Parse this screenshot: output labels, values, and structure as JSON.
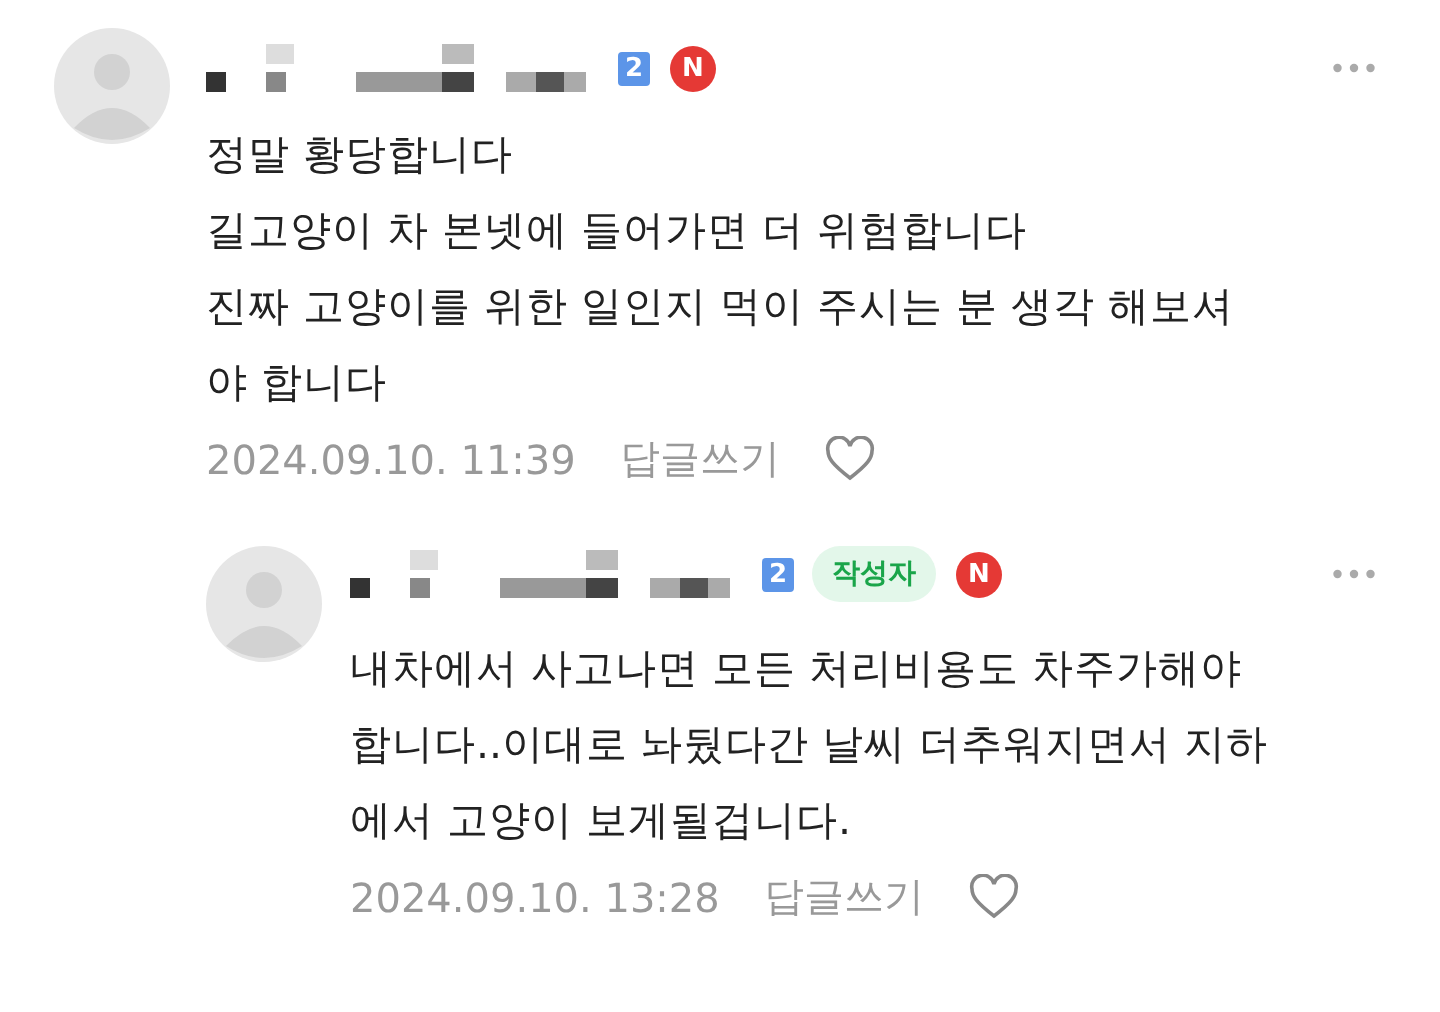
{
  "comments": [
    {
      "reply": false,
      "level_badge": "2",
      "new_badge": "N",
      "lines": [
        "정말 황당합니다",
        "길고양이 차 본넷에 들어가면 더 위험합니다",
        "진짜 고양이를 위한 일인지 먹이 주시는 분 생각 해보셔",
        "야 합니다"
      ],
      "date": "2024.09.10. 11:39",
      "reply_link": "답글쓰기",
      "liked": false
    },
    {
      "reply": true,
      "level_badge": "2",
      "new_badge": "N",
      "author_tag": "작성자",
      "lines": [
        "내차에서 사고나면 모든 처리비용도 차주가해야",
        "합니다..이대로 놔뒀다간 날씨 더추워지면서 지하",
        "에서 고양이 보게될겁니다."
      ],
      "date": "2024.09.10. 13:28",
      "reply_link": "답글쓰기",
      "liked": false
    }
  ]
}
